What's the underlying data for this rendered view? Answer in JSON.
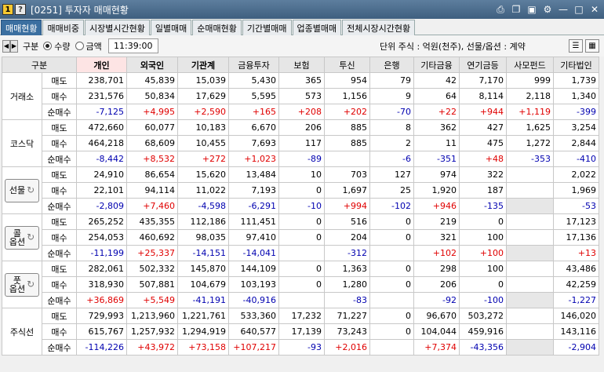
{
  "window": {
    "badge1": "1",
    "badge2": "?",
    "title": "[0251] 투자자 매매현황"
  },
  "tabs": [
    "매매현황",
    "매매비중",
    "시장별시간현황",
    "일별매매",
    "순매매현황",
    "기간별매매",
    "업종별매매",
    "전체시장시간현황"
  ],
  "toolbar": {
    "section_label": "구분",
    "radio_qty": "수량",
    "radio_amt": "금액",
    "time": "11:39:00",
    "unit": "단위 주식 : 억원(천주), 선물/옵션 : 계약"
  },
  "columns": [
    "구분",
    "개인",
    "외국인",
    "기관계",
    "금융투자",
    "보험",
    "투신",
    "은행",
    "기타금융",
    "연기금등",
    "사모펀드",
    "기타법인"
  ],
  "row_labels": [
    "매도",
    "매수",
    "순매수"
  ],
  "groups": [
    {
      "name": "거래소",
      "rows": [
        [
          "238,701",
          "45,839",
          "15,039",
          "5,430",
          "365",
          "954",
          "79",
          "42",
          "7,170",
          "999",
          "1,739"
        ],
        [
          "231,576",
          "50,834",
          "17,629",
          "5,595",
          "573",
          "1,156",
          "9",
          "64",
          "8,114",
          "2,118",
          "1,340"
        ],
        [
          "-7,125",
          "+4,995",
          "+2,590",
          "+165",
          "+208",
          "+202",
          "-70",
          "+22",
          "+944",
          "+1,119",
          "-399"
        ]
      ]
    },
    {
      "name": "코스닥",
      "rows": [
        [
          "472,660",
          "60,077",
          "10,183",
          "6,670",
          "206",
          "885",
          "8",
          "362",
          "427",
          "1,625",
          "3,254"
        ],
        [
          "464,218",
          "68,609",
          "10,455",
          "7,693",
          "117",
          "885",
          "2",
          "11",
          "475",
          "1,272",
          "2,844"
        ],
        [
          "-8,442",
          "+8,532",
          "+272",
          "+1,023",
          "-89",
          "",
          "-6",
          "-351",
          "+48",
          "-353",
          "-410"
        ]
      ]
    },
    {
      "name": "선물",
      "rows": [
        [
          "24,910",
          "86,654",
          "15,620",
          "13,484",
          "10",
          "703",
          "127",
          "974",
          "322",
          "",
          "2,022"
        ],
        [
          "22,101",
          "94,114",
          "11,022",
          "7,193",
          "0",
          "1,697",
          "25",
          "1,920",
          "187",
          "",
          "1,969"
        ],
        [
          "-2,809",
          "+7,460",
          "-4,598",
          "-6,291",
          "-10",
          "+994",
          "-102",
          "+946",
          "-135",
          "",
          "-53"
        ]
      ]
    },
    {
      "name_top": "콜",
      "name_bottom": "옵션",
      "rows": [
        [
          "265,252",
          "435,355",
          "112,186",
          "111,451",
          "0",
          "516",
          "0",
          "219",
          "0",
          "",
          "17,123"
        ],
        [
          "254,053",
          "460,692",
          "98,035",
          "97,410",
          "0",
          "204",
          "0",
          "321",
          "100",
          "",
          "17,136"
        ],
        [
          "-11,199",
          "+25,337",
          "-14,151",
          "-14,041",
          "",
          "-312",
          "",
          "+102",
          "+100",
          "",
          "+13"
        ]
      ]
    },
    {
      "name_top": "풋",
      "name_bottom": "옵션",
      "rows": [
        [
          "282,061",
          "502,332",
          "145,870",
          "144,109",
          "0",
          "1,363",
          "0",
          "298",
          "100",
          "",
          "43,486"
        ],
        [
          "318,930",
          "507,881",
          "104,679",
          "103,193",
          "0",
          "1,280",
          "0",
          "206",
          "0",
          "",
          "42,259"
        ],
        [
          "+36,869",
          "+5,549",
          "-41,191",
          "-40,916",
          "",
          "-83",
          "",
          "-92",
          "-100",
          "",
          "-1,227"
        ]
      ]
    },
    {
      "name": "주식선",
      "rows": [
        [
          "729,993",
          "1,213,960",
          "1,221,761",
          "533,360",
          "17,232",
          "71,227",
          "0",
          "96,670",
          "503,272",
          "",
          "146,020"
        ],
        [
          "615,767",
          "1,257,932",
          "1,294,919",
          "640,577",
          "17,139",
          "73,243",
          "0",
          "104,044",
          "459,916",
          "",
          "143,116"
        ],
        [
          "-114,226",
          "+43,972",
          "+73,158",
          "+107,217",
          "-93",
          "+2,016",
          "",
          "+7,374",
          "-43,356",
          "",
          "-2,904"
        ]
      ]
    }
  ],
  "colors": {
    "positive": "#e00000",
    "negative": "#0000b0",
    "active_tab": "#3b6fa0"
  }
}
